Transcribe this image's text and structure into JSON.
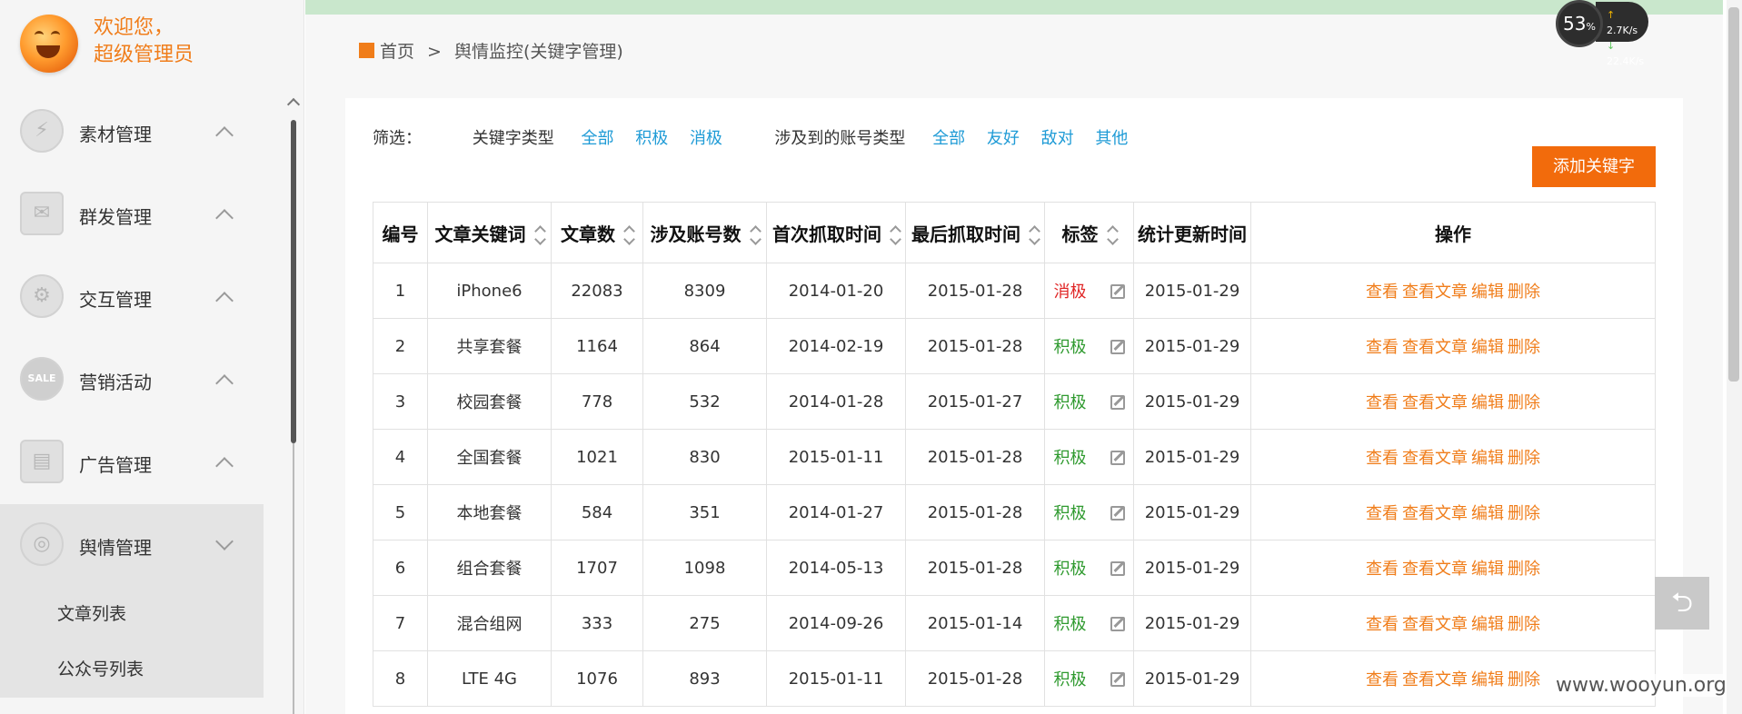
{
  "sidebar": {
    "welcome_line1": "欢迎您，",
    "welcome_line2": "超级管理员",
    "items": [
      {
        "label": "素材管理",
        "icon": "lightning-icon"
      },
      {
        "label": "群发管理",
        "icon": "envelope-icon"
      },
      {
        "label": "交互管理",
        "icon": "gear-icon"
      },
      {
        "label": "营销活动",
        "icon": "sale-badge-icon",
        "icon_text": "SALE"
      },
      {
        "label": "广告管理",
        "icon": "billboard-icon"
      },
      {
        "label": "舆情管理",
        "icon": "monitor-disc-icon"
      }
    ],
    "sub_items": [
      "文章列表",
      "公众号列表"
    ]
  },
  "breadcrumb": {
    "home": "首页",
    "separator": ">",
    "current": "舆情监控(关键字管理)"
  },
  "filter": {
    "label": "筛选：",
    "keyword_type_label": "关键字类型",
    "keyword_type_options": [
      "全部",
      "积极",
      "消极"
    ],
    "account_type_label": "涉及到的账号类型",
    "account_type_options": [
      "全部",
      "友好",
      "敌对",
      "其他"
    ]
  },
  "add_button": "添加关键字",
  "table": {
    "headers": [
      "编号",
      "文章关键词",
      "文章数",
      "涉及账号数",
      "首次抓取时间",
      "最后抓取时间",
      "标签",
      "统计更新时间",
      "操作"
    ],
    "ops": [
      "查看",
      "查看文章",
      "编辑",
      "删除"
    ],
    "rows": [
      {
        "id": "1",
        "keyword": "iPhone6",
        "articles": "22083",
        "accounts": "8309",
        "first": "2014-01-20",
        "last": "2015-01-28",
        "tag": "消极",
        "updated": "2015-01-29"
      },
      {
        "id": "2",
        "keyword": "共享套餐",
        "articles": "1164",
        "accounts": "864",
        "first": "2014-02-19",
        "last": "2015-01-28",
        "tag": "积极",
        "updated": "2015-01-29"
      },
      {
        "id": "3",
        "keyword": "校园套餐",
        "articles": "778",
        "accounts": "532",
        "first": "2014-01-28",
        "last": "2015-01-27",
        "tag": "积极",
        "updated": "2015-01-29"
      },
      {
        "id": "4",
        "keyword": "全国套餐",
        "articles": "1021",
        "accounts": "830",
        "first": "2015-01-11",
        "last": "2015-01-28",
        "tag": "积极",
        "updated": "2015-01-29"
      },
      {
        "id": "5",
        "keyword": "本地套餐",
        "articles": "584",
        "accounts": "351",
        "first": "2014-01-27",
        "last": "2015-01-28",
        "tag": "积极",
        "updated": "2015-01-29"
      },
      {
        "id": "6",
        "keyword": "组合套餐",
        "articles": "1707",
        "accounts": "1098",
        "first": "2014-05-13",
        "last": "2015-01-28",
        "tag": "积极",
        "updated": "2015-01-29"
      },
      {
        "id": "7",
        "keyword": "混合组网",
        "articles": "333",
        "accounts": "275",
        "first": "2014-09-26",
        "last": "2015-01-14",
        "tag": "积极",
        "updated": "2015-01-29"
      },
      {
        "id": "8",
        "keyword": "LTE 4G",
        "articles": "1076",
        "accounts": "893",
        "first": "2015-01-11",
        "last": "2015-01-28",
        "tag": "积极",
        "updated": "2015-01-29"
      }
    ]
  },
  "speed_widget": {
    "percent": "53",
    "percent_unit": "%",
    "up": "2.7",
    "down": "22.4",
    "unit": "K/s"
  },
  "watermark": "www.wooyun.org",
  "colors": {
    "accent": "#f07d1a",
    "button": "#f26b0c",
    "link": "#1f9bd6",
    "negative": "#e02525",
    "positive": "#2f9a2f"
  }
}
